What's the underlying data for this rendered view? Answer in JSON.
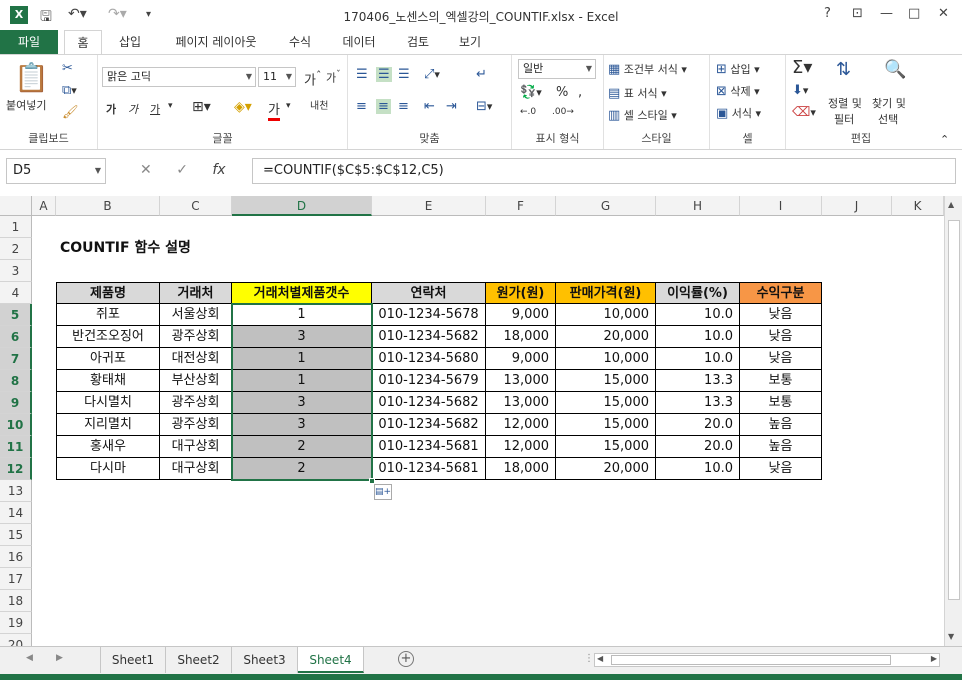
{
  "titlebar": {
    "title": "170406_노센스의_엑셀강의_COUNTIF.xlsx - Excel",
    "help": "?"
  },
  "ribbon_tabs": {
    "file": "파일",
    "items": [
      "홈",
      "삽입",
      "페이지 레이아웃",
      "수식",
      "데이터",
      "검토",
      "보기"
    ],
    "active": "홈"
  },
  "ribbon": {
    "clipboard": {
      "paste": "붙여넣기",
      "label": "클립보드"
    },
    "font": {
      "name": "맑은 고딕",
      "size": "11",
      "bold": "가",
      "italic": "가",
      "underline": "가",
      "label": "글꼴",
      "phonetic": "내천"
    },
    "alignment": {
      "label": "맞춤"
    },
    "number": {
      "format": "일반",
      "label": "표시 형식"
    },
    "styles": {
      "conditional": "조건부 서식",
      "table": "표 서식",
      "cell": "셀 스타일",
      "label": "스타일"
    },
    "cells": {
      "insert": "삽입",
      "delete": "삭제",
      "format": "서식",
      "label": "셀"
    },
    "editing": {
      "sort": "정렬 및",
      "sort2": "필터",
      "find": "찾기 및",
      "find2": "선택",
      "label": "편집"
    }
  },
  "formula_bar": {
    "name_box": "D5",
    "fx": "fx",
    "formula": "=COUNTIF($C$5:$C$12,C5)"
  },
  "columns": [
    "A",
    "B",
    "C",
    "D",
    "E",
    "F",
    "G",
    "H",
    "I",
    "J",
    "K"
  ],
  "rows": [
    "1",
    "2",
    "3",
    "4",
    "5",
    "6",
    "7",
    "8",
    "9",
    "10",
    "11",
    "12",
    "13",
    "14",
    "15",
    "16",
    "17",
    "18",
    "19",
    "20"
  ],
  "sheet": {
    "title": "COUNTIF 함수 설명",
    "headers": [
      "제품명",
      "거래처",
      "거래처별제품갯수",
      "연락처",
      "원가(원)",
      "판매가격(원)",
      "이익률(%)",
      "수익구분"
    ],
    "data": [
      [
        "쥐포",
        "서울상회",
        "1",
        "010-1234-5678",
        "9,000",
        "10,000",
        "10.0",
        "낮음"
      ],
      [
        "반건조오징어",
        "광주상회",
        "3",
        "010-1234-5682",
        "18,000",
        "20,000",
        "10.0",
        "낮음"
      ],
      [
        "아귀포",
        "대전상회",
        "1",
        "010-1234-5680",
        "9,000",
        "10,000",
        "10.0",
        "낮음"
      ],
      [
        "황태채",
        "부산상회",
        "1",
        "010-1234-5679",
        "13,000",
        "15,000",
        "13.3",
        "보통"
      ],
      [
        "다시멸치",
        "광주상회",
        "3",
        "010-1234-5682",
        "13,000",
        "15,000",
        "13.3",
        "보통"
      ],
      [
        "지리멸치",
        "광주상회",
        "3",
        "010-1234-5682",
        "12,000",
        "15,000",
        "20.0",
        "높음"
      ],
      [
        "홍새우",
        "대구상회",
        "2",
        "010-1234-5681",
        "12,000",
        "15,000",
        "20.0",
        "높음"
      ],
      [
        "다시마",
        "대구상회",
        "2",
        "010-1234-5681",
        "18,000",
        "20,000",
        "10.0",
        "낮음"
      ]
    ]
  },
  "colors": {
    "accent": "#217346",
    "header_yellow": "#ffff00",
    "header_orange": "#ffc000",
    "header_red_orange": "#f79646",
    "header_gray": "#d9d9d9",
    "selected_fill": "#c0c0c0"
  },
  "sheet_tabs": {
    "items": [
      "Sheet1",
      "Sheet2",
      "Sheet3",
      "Sheet4"
    ],
    "active": "Sheet4",
    "add": "+"
  }
}
